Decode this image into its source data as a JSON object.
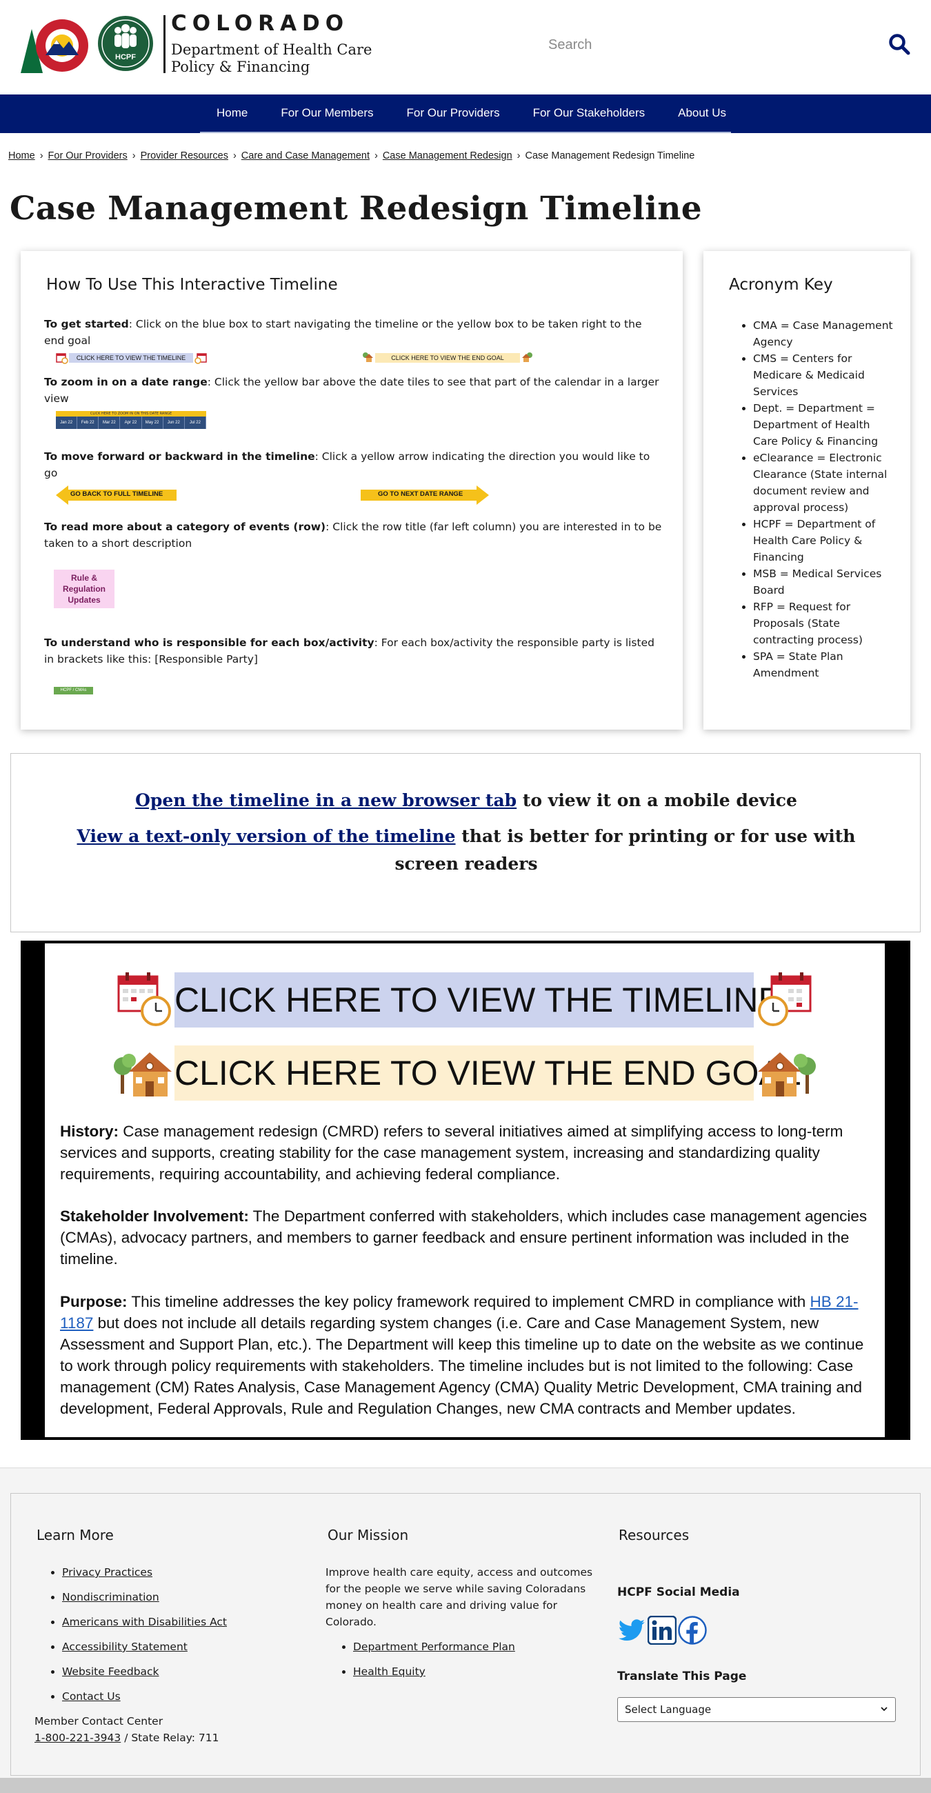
{
  "header": {
    "state_name": "COLORADO",
    "dept_line1": "Department of Health Care",
    "dept_line2": "Policy & Financing",
    "hcpf_badge": "HCPF",
    "search_placeholder": "Search"
  },
  "nav": {
    "items": [
      {
        "label": "Home"
      },
      {
        "label": "For Our Members"
      },
      {
        "label": "For Our Providers"
      },
      {
        "label": "For Our Stakeholders"
      },
      {
        "label": "About Us"
      }
    ]
  },
  "breadcrumb": {
    "items": [
      "Home",
      "For Our Providers",
      "Provider Resources",
      "Care and Case Management",
      "Case Management Redesign"
    ],
    "current": "Case Management Redesign Timeline",
    "separator": "›"
  },
  "page_title": "Case Management Redesign Timeline",
  "howto": {
    "title": "How To Use This Interactive Timeline",
    "start_bold": "To get started",
    "start_text": ": Click on the blue box to start navigating the timeline or the yellow box to be taken right to the end goal",
    "sample_blue": "CLICK HERE TO VIEW THE TIMELINE",
    "sample_yellow": "CLICK HERE TO VIEW THE END GOAL",
    "zoom_bold": "To zoom in on a date range",
    "zoom_text": ": Click the yellow bar above the date tiles to see that part of the calendar in a larger view",
    "zoom_bar_label": "CLICK HERE TO ZOOM IN ON THIS DATE RANGE",
    "zoom_tiles": [
      "Jan 22",
      "Feb 22",
      "Mar 22",
      "Apr 22",
      "May 22",
      "Jun 22",
      "Jul 22"
    ],
    "move_bold": "To move forward or backward in the timeline",
    "move_text": ": Click a yellow arrow indicating the direction you would like to go",
    "arrow_back": "GO BACK TO FULL TIMELINE",
    "arrow_next": "GO TO NEXT DATE RANGE",
    "read_bold": "To read more about a category of events (row)",
    "read_text": ": Click the row title (far left column) you are interested in to be taken to a short description",
    "row_tile": "Rule & Regulation Updates",
    "resp_bold": "To understand who is responsible for each box/activity",
    "resp_text": ": For each box/activity the responsible party is listed in brackets like this: [Responsible Party]",
    "party_tag": "HCPF / CMAs"
  },
  "acronyms": {
    "title": "Acronym Key",
    "items": [
      "CMA = Case Management Agency",
      "CMS = Centers for Medicare & Medicaid Services",
      "Dept. = Department = Department of Health Care Policy & Financing",
      "eClearance = Electronic Clearance (State internal document review and approval process)",
      "HCPF = Department of Health Care Policy & Financing",
      "MSB = Medical Services Board",
      "RFP = Request for Proposals (State contracting process)",
      "SPA = State Plan Amendment"
    ]
  },
  "links": {
    "open_link": "Open the timeline in a new browser tab",
    "open_rest": " to view it on a mobile device",
    "text_link": "View a text-only version of the timeline",
    "text_rest": " that is better for printing or for use with screen readers"
  },
  "embed": {
    "btn_timeline": "CLICK HERE TO VIEW THE TIMELINE",
    "btn_goal": "CLICK HERE TO VIEW THE END GOAL",
    "history_label": "History:",
    "history_text": " Case management redesign (CMRD) refers to several initiatives aimed at simplifying access to long-term services and supports, creating stability for the case management system, increasing and standardizing quality requirements, requiring accountability, and achieving federal compliance.",
    "stake_label": "Stakeholder Involvement:",
    "stake_text": " The Department conferred with stakeholders, which includes case management agencies (CMAs), advocacy partners, and members to garner feedback and ensure pertinent information was included in the timeline.",
    "purpose_label": "Purpose:",
    "purpose_text1": " This timeline addresses the key policy framework required to implement CMRD in compliance with ",
    "purpose_link": "HB 21-1187",
    "purpose_text2": " but does not include all details regarding system changes (i.e. Care and Case Management System, new Assessment and Support Plan, etc.). The Department will keep this timeline up to date on the website as we continue to work through policy requirements with stakeholders. The timeline includes but is not limited to the following: Case management (CM) Rates Analysis, Case Management Agency (CMA) Quality Metric Development, CMA training and development, Federal Approvals, Rule and Regulation Changes, new CMA contracts and Member updates."
  },
  "footer": {
    "learn_title": "Learn More",
    "learn_items": [
      "Privacy Practices",
      "Nondiscrimination",
      "Americans with Disabilities Act",
      "Accessibility Statement",
      "Website Feedback",
      "Contact Us"
    ],
    "contact_label": "Member Contact Center",
    "contact_phone": "1-800-221-3943",
    "contact_relay": " / State Relay: 711",
    "mission_title": "Our Mission",
    "mission_text": "Improve health care equity, access and outcomes for the people we serve while saving Coloradans money on health care and driving value for Colorado.",
    "mission_items": [
      "Department Performance Plan",
      "Health Equity"
    ],
    "resources_title": "Resources",
    "social_title": "HCPF Social Media",
    "translate_title": "Translate This Page",
    "language_selected": "Select Language"
  },
  "colors": {
    "nav_bg": "#001970",
    "link_blue": "#001970",
    "timeline_blue": "#ccd3ee",
    "timeline_yellow": "#fdefd0",
    "arrow_yellow": "#f5c11a"
  }
}
